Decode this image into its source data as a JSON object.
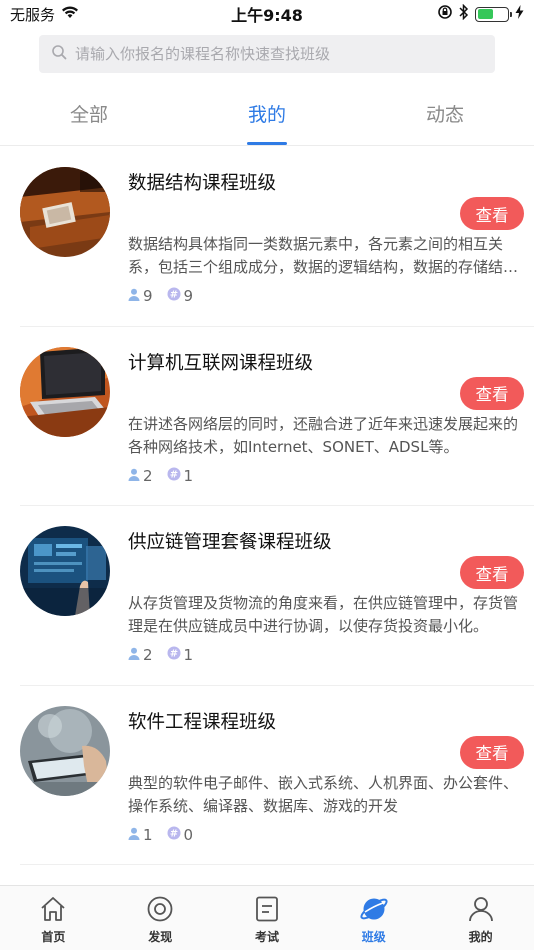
{
  "status_bar": {
    "carrier": "无服务",
    "time": "上午9:48",
    "battery_level": 0.55,
    "battery_color": "#35c759"
  },
  "search": {
    "placeholder": "请输入你报名的课程名称快速查找班级"
  },
  "tabs": [
    {
      "label": "全部",
      "active": false
    },
    {
      "label": "我的",
      "active": true
    },
    {
      "label": "动态",
      "active": false
    }
  ],
  "classes": [
    {
      "title": "数据结构课程班级",
      "button": "查看",
      "description": "数据结构具体指同一类数据元素中，各元素之间的相互关系，包括三个组成成分，数据的逻辑结构，数据的存储结构和数据运算结构。",
      "members": "9",
      "topics": "9"
    },
    {
      "title": "计算机互联网课程班级",
      "button": "查看",
      "description": "在讲述各网络层的同时，还融合进了近年来迅速发展起来的各种网络技术，如Internet、SONET、ADSL等。",
      "members": "2",
      "topics": "1"
    },
    {
      "title": "供应链管理套餐课程班级",
      "button": "查看",
      "description": "从存货管理及货物流的角度来看，在供应链管理中，存货管理是在供应链成员中进行协调，以使存货投资最小化。",
      "members": "2",
      "topics": "1"
    },
    {
      "title": "软件工程课程班级",
      "button": "查看",
      "description": "典型的软件电子邮件、嵌入式系统、人机界面、办公套件、操作系统、编译器、数据库、游戏的开发",
      "members": "1",
      "topics": "0"
    }
  ],
  "bottom_nav": [
    {
      "label": "首页",
      "icon": "home-icon",
      "active": false
    },
    {
      "label": "发现",
      "icon": "discover-icon",
      "active": false
    },
    {
      "label": "考试",
      "icon": "exam-icon",
      "active": false
    },
    {
      "label": "班级",
      "icon": "class-planet-icon",
      "active": true
    },
    {
      "label": "我的",
      "icon": "profile-icon",
      "active": false
    }
  ],
  "colors": {
    "accent": "#2f7be5",
    "view_button": "#f25a5a"
  }
}
